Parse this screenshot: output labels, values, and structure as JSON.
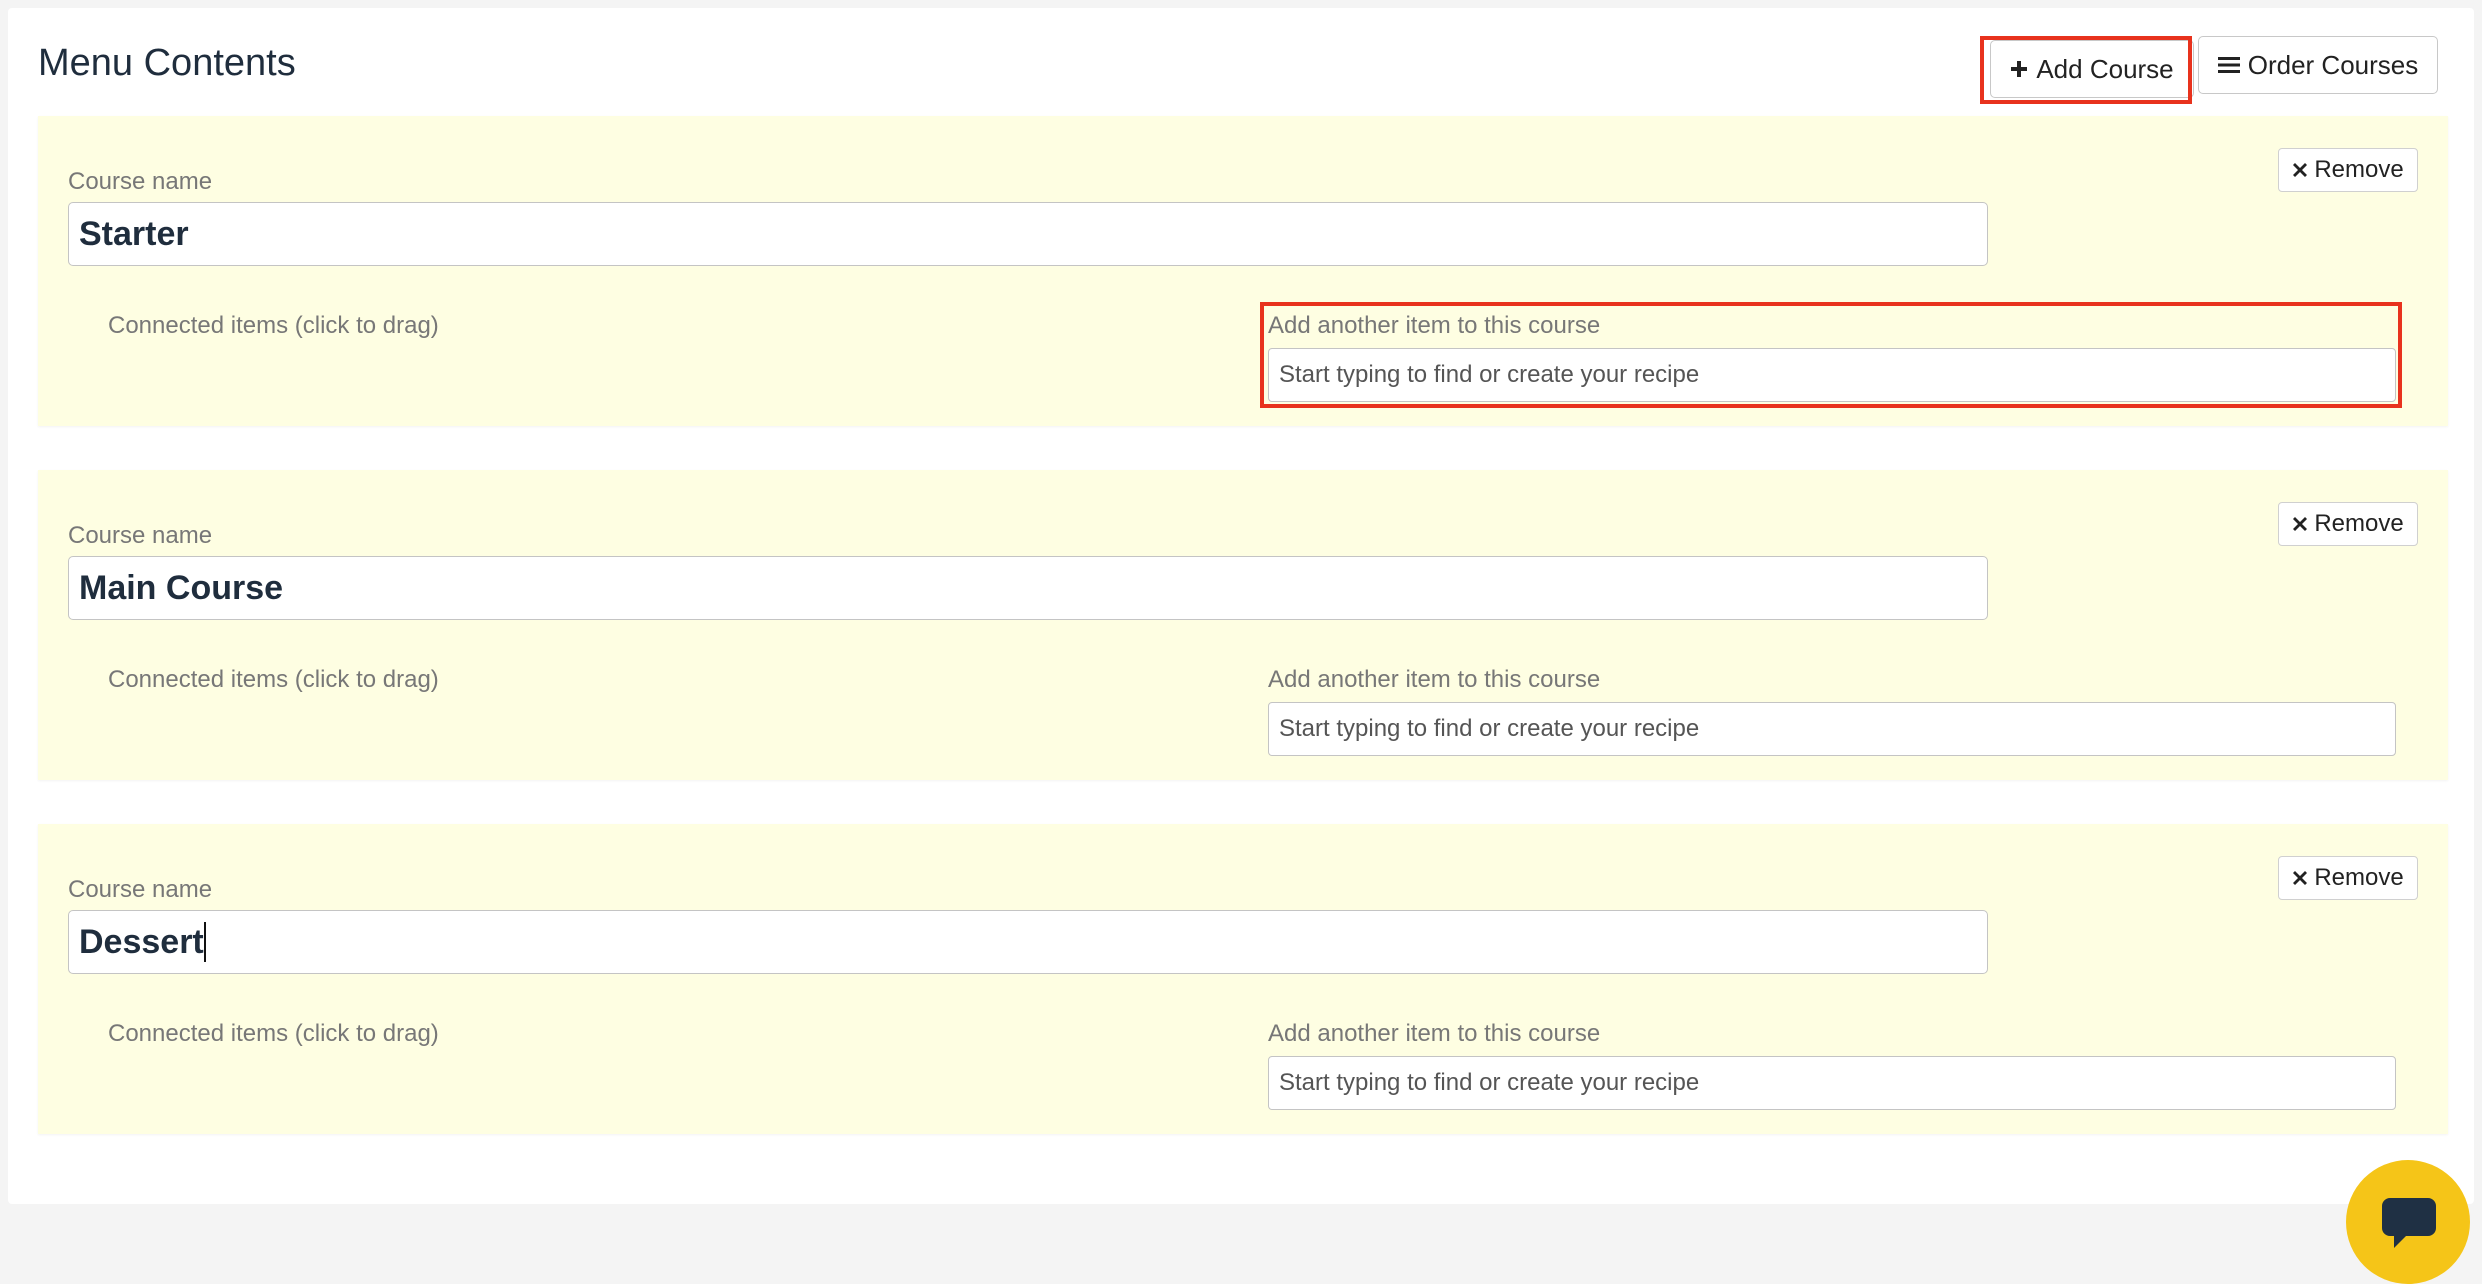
{
  "header": {
    "title": "Menu Contents",
    "add_course_label": "Add Course",
    "order_courses_label": "Order Courses"
  },
  "courses": [
    {
      "course_name_label": "Course name",
      "name": "Starter",
      "remove_label": "Remove",
      "connected_label": "Connected items (click to drag)",
      "add_item_label": "Add another item to this course",
      "add_item_placeholder": "Start typing to find or create your recipe"
    },
    {
      "course_name_label": "Course name",
      "name": "Main Course",
      "remove_label": "Remove",
      "connected_label": "Connected items (click to drag)",
      "add_item_label": "Add another item to this course",
      "add_item_placeholder": "Start typing to find or create your recipe"
    },
    {
      "course_name_label": "Course name",
      "name": "Dessert",
      "remove_label": "Remove",
      "connected_label": "Connected items (click to drag)",
      "add_item_label": "Add another item to this course",
      "add_item_placeholder": "Start typing to find or create your recipe"
    }
  ],
  "icons": {
    "add": "plus-icon",
    "order": "list-icon",
    "remove": "close-icon",
    "chat": "chat-icon"
  },
  "colors": {
    "course_background": "#fefee2",
    "highlight": "#e8321d",
    "chat_button": "#f5c518"
  }
}
